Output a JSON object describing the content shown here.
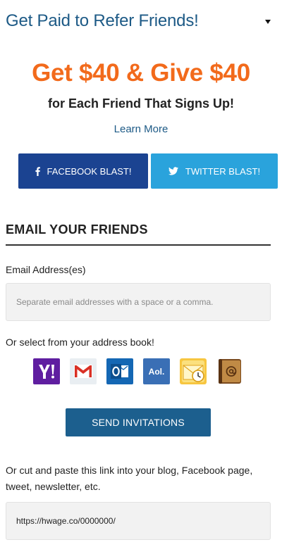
{
  "header": {
    "title": "Get Paid to Refer Friends!",
    "toggle_icon": "triangle-down-icon"
  },
  "promo": {
    "headline": "Get $40 & Give $40",
    "subheadline": "for Each Friend That Signs Up!",
    "learn_more": "Learn More",
    "headline_color": "#f26a1b"
  },
  "share_buttons": {
    "facebook": {
      "label": "FACEBOOK BLAST!",
      "icon": "facebook-icon",
      "color": "#1b4391"
    },
    "twitter": {
      "label": "TWITTER BLAST!",
      "icon": "twitter-icon",
      "color": "#2aa3dc"
    }
  },
  "email_section": {
    "title": "EMAIL YOUR FRIENDS",
    "field_label": "Email Address(es)",
    "field_placeholder": "Separate email addresses with a space or a comma.",
    "field_value": "",
    "address_book_label": "Or select from your address book!",
    "providers": [
      {
        "name": "Yahoo",
        "icon": "yahoo-icon"
      },
      {
        "name": "Gmail",
        "icon": "gmail-icon"
      },
      {
        "name": "Outlook",
        "icon": "outlook-icon"
      },
      {
        "name": "AOL",
        "icon": "aol-icon",
        "text": "Aol."
      },
      {
        "name": "Outlook Express",
        "icon": "outlook-express-icon"
      },
      {
        "name": "Address Book",
        "icon": "address-book-icon"
      }
    ],
    "send_button": "SEND INVITATIONS"
  },
  "share_link": {
    "text": "Or cut and paste this link into your blog, Facebook page, tweet, newsletter, etc.",
    "url": "https://hwage.co/0000000/"
  },
  "colors": {
    "header_blue": "#1d5a86",
    "send_button": "#1c5f8e"
  }
}
